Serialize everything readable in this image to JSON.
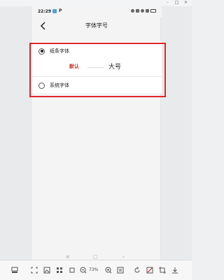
{
  "window": {
    "controls": [
      "-",
      "□",
      "×"
    ]
  },
  "status_bar": {
    "time": "22:29",
    "app_letter": "P"
  },
  "nav": {
    "title": "字体字号"
  },
  "font_options": [
    {
      "label": "纸条字体",
      "selected": true
    },
    {
      "label": "系统字体",
      "selected": false
    }
  ],
  "size_slider": {
    "default_label": "默认",
    "large_label": "大号"
  },
  "phone_nav": {
    "menu": "≡",
    "home": "▢",
    "back": "‹"
  },
  "toolbar": {
    "zoom": "73%"
  },
  "colors": {
    "highlight": "#e0262b",
    "default_size_text": "#c8362c"
  }
}
